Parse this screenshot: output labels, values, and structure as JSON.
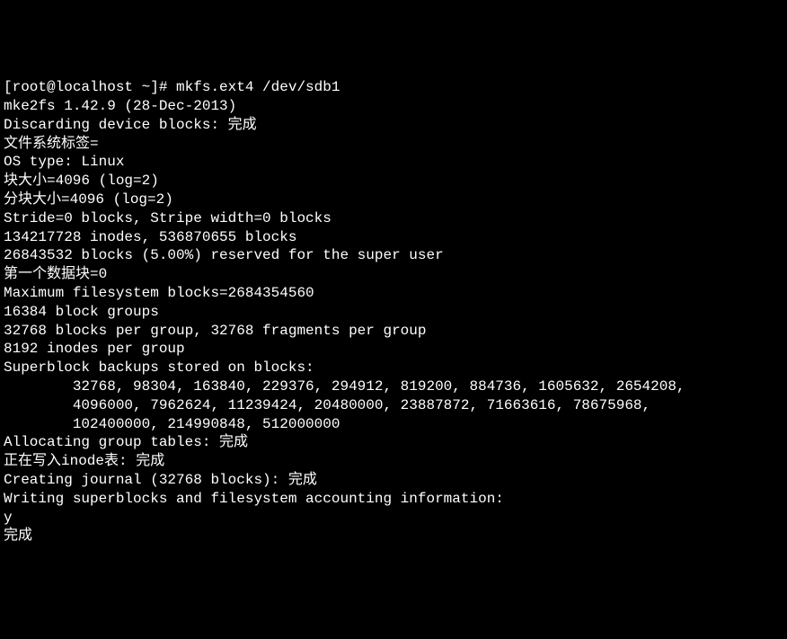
{
  "terminal": {
    "prompt": "[root@localhost ~]# ",
    "command": "mkfs.ext4 /dev/sdb1",
    "output": {
      "l0": "mke2fs 1.42.9 (28-Dec-2013)",
      "l1": "Discarding device blocks: 完成",
      "l2": "文件系统标签=",
      "l3": "OS type: Linux",
      "l4": "块大小=4096 (log=2)",
      "l5": "分块大小=4096 (log=2)",
      "l6": "Stride=0 blocks, Stripe width=0 blocks",
      "l7": "134217728 inodes, 536870655 blocks",
      "l8": "26843532 blocks (5.00%) reserved for the super user",
      "l9": "第一个数据块=0",
      "l10": "Maximum filesystem blocks=2684354560",
      "l11": "16384 block groups",
      "l12": "32768 blocks per group, 32768 fragments per group",
      "l13": "8192 inodes per group",
      "l14": "Superblock backups stored on blocks: ",
      "l15": "32768, 98304, 163840, 229376, 294912, 819200, 884736, 1605632, 2654208, ",
      "l16": "4096000, 7962624, 11239424, 20480000, 23887872, 71663616, 78675968, ",
      "l17": "102400000, 214990848, 512000000",
      "l18": "",
      "l19": "Allocating group tables: 完成",
      "l20": "正在写入inode表: 完成",
      "l21": "Creating journal (32768 blocks): 完成",
      "l22": "Writing superblocks and filesystem accounting information: ",
      "l23": "y",
      "l24": "完成"
    }
  }
}
